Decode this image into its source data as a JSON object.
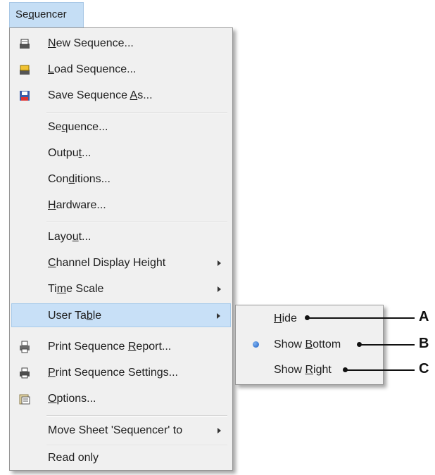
{
  "menu_bar": {
    "title": "Sequencer"
  },
  "menu": {
    "items": [
      {
        "label": "New Sequence...",
        "icon": "new-sequence-icon"
      },
      {
        "label": "Load Sequence...",
        "icon": "load-sequence-icon"
      },
      {
        "label": "Save Sequence As...",
        "icon": "save-sequence-icon"
      },
      {
        "label": "Sequence..."
      },
      {
        "label": "Output..."
      },
      {
        "label": "Conditions..."
      },
      {
        "label": "Hardware..."
      },
      {
        "label": "Layout..."
      },
      {
        "label": "Channel Display Height",
        "has_submenu": true
      },
      {
        "label": "Time Scale",
        "has_submenu": true
      },
      {
        "label": "User Table",
        "has_submenu": true,
        "highlighted": true
      },
      {
        "label": "Print Sequence Report...",
        "icon": "print-report-icon"
      },
      {
        "label": "Print Sequence Settings...",
        "icon": "print-settings-icon"
      },
      {
        "label": "Options...",
        "icon": "options-icon"
      },
      {
        "label": "Move Sheet 'Sequencer' to",
        "has_submenu": true
      },
      {
        "label": "Read only"
      }
    ]
  },
  "submenu": {
    "items": [
      {
        "label": "Hide",
        "selected": false
      },
      {
        "label": "Show Bottom",
        "selected": true
      },
      {
        "label": "Show Right",
        "selected": false
      }
    ]
  },
  "callouts": [
    {
      "letter": "A"
    },
    {
      "letter": "B"
    },
    {
      "letter": "C"
    }
  ],
  "colors": {
    "highlight": "#c8e0f7",
    "menu_background": "#f0f0f0",
    "selected_radio": "#1c5fc4"
  }
}
